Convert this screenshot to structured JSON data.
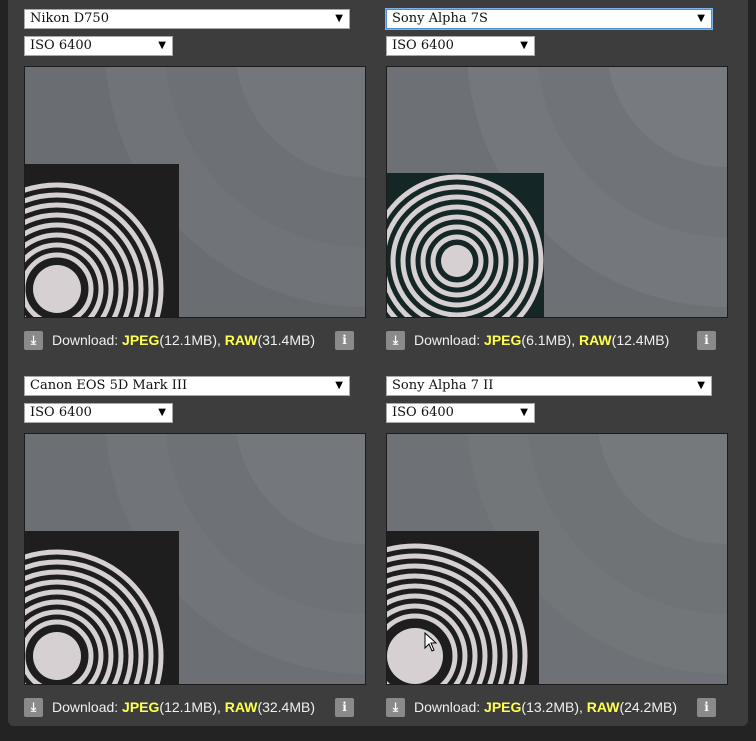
{
  "panels": [
    {
      "camera": "Nikon D750",
      "iso": "ISO 6400",
      "download_label": "Download:",
      "jpeg_label": "JPEG",
      "jpeg_size": "(12.1MB),",
      "raw_label": "RAW",
      "raw_size": "(31.4MB)"
    },
    {
      "camera": "Sony Alpha 7S",
      "iso": "ISO 6400",
      "download_label": "Download:",
      "jpeg_label": "JPEG",
      "jpeg_size": "(6.1MB),",
      "raw_label": "RAW",
      "raw_size": "(12.4MB)"
    },
    {
      "camera": "Canon EOS 5D Mark III",
      "iso": "ISO 6400",
      "download_label": "Download:",
      "jpeg_label": "JPEG",
      "jpeg_size": "(12.1MB),",
      "raw_label": "RAW",
      "raw_size": "(32.4MB)"
    },
    {
      "camera": "Sony Alpha 7 II",
      "iso": "ISO 6400",
      "download_label": "Download:",
      "jpeg_label": "JPEG",
      "jpeg_size": "(13.2MB),",
      "raw_label": "RAW",
      "raw_size": "(24.2MB)"
    }
  ],
  "icons": {
    "download": "download-icon",
    "info": "info-icon",
    "dropdown": "chevron-down-icon"
  },
  "colors": {
    "background": "#3d3d3d",
    "format_highlight": "#ffff4d",
    "select_focus": "#4a90d9"
  }
}
